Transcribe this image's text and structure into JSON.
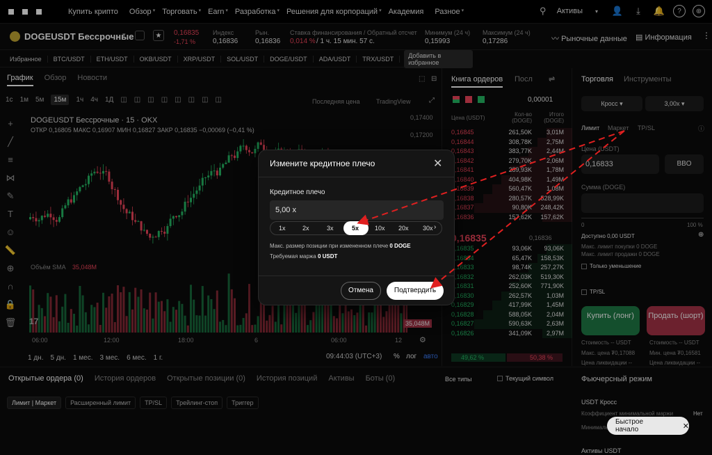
{
  "nav": {
    "items": [
      "Купить крипто",
      "Обзор",
      "Торговать",
      "Earn",
      "Разработка",
      "Решения для корпораций",
      "Академия",
      "Разное"
    ],
    "assets_label": "Активы"
  },
  "ticker": {
    "symbol": "DOGEUSDT Бессрочные",
    "price": "0,16835",
    "change": "-1,71 %",
    "index_label": "Индекс",
    "index_value": "0,16836",
    "mark_label": "Рын.",
    "mark_value": "0,16836",
    "funding_label": "Ставка финансирования / Обратный отсчет",
    "funding_rate": "0,014 %",
    "funding_countdown": "/ 1 ч. 15 мин. 57 с.",
    "min_label": "Минимум (24 ч)",
    "min_value": "0,15993",
    "max_label": "Максимум (24 ч)",
    "max_value": "0,17286",
    "market_data": "Рыночные данные",
    "info": "Информация"
  },
  "favorites": {
    "label": "Избранное",
    "pairs": [
      "BTC/USDT",
      "ETH/USDT",
      "OKB/USDT",
      "XRP/USDT",
      "SOL/USDT",
      "DOGE/USDT",
      "ADA/USDT",
      "TRX/USDT"
    ],
    "add": "Добавить в избранное"
  },
  "chart": {
    "tabs": [
      "График",
      "Обзор",
      "Новости"
    ],
    "timeframes": [
      "1с",
      "1м",
      "5м",
      "15м",
      "1ч",
      "4ч",
      "1Д"
    ],
    "active_tf": "15м",
    "last_price_label": "Последняя цена",
    "tradingview_label": "TradingView",
    "title": "DOGEUSDT Бессрочные · 15 · OKX",
    "ohlc": "ОТКР 0,16805 МАКС 0,16907 МИН 0,16827 ЗАКР 0,16835 −0,00069 (−0,41 %)",
    "volume_label": "Объём SMA",
    "volume_value": "35,048M",
    "volume_axis_value": "35,048M",
    "price_ticks": [
      "0,17400",
      "0,17200"
    ],
    "time_ticks": [
      "06:00",
      "12:00",
      "18:00",
      "6",
      "06:00",
      "12"
    ],
    "ranges": [
      "1 дн.",
      "5 дн.",
      "1 мес.",
      "3 мес.",
      "6 мес.",
      "1 г."
    ],
    "clock": "09:44:03 (UTC+3)",
    "percent": "%",
    "log": "лог",
    "auto": "авто"
  },
  "orderbook": {
    "tab_book": "Книга ордеров",
    "tab_last": "Посл",
    "step": "0,00001",
    "col_price": "Цена (USDT)",
    "col_qty": "Кол-во (DOGE)",
    "col_total": "Итого (DOGE)",
    "asks": [
      [
        "0,16845",
        "261,50K",
        "3,01M"
      ],
      [
        "0,16844",
        "308,78K",
        "2,75M"
      ],
      [
        "0,16843",
        "383,77K",
        "2,44M"
      ],
      [
        "0,16842",
        "279,70K",
        "2,06M"
      ],
      [
        "0,16841",
        "289,93K",
        "1,78M"
      ],
      [
        "0,16840",
        "404,98K",
        "1,49M"
      ],
      [
        "0,16839",
        "560,47K",
        "1,08M"
      ],
      [
        "0,16838",
        "280,57K",
        "528,99K"
      ],
      [
        "0,16837",
        "90,80K",
        "248,42K"
      ],
      [
        "0,16836",
        "157,62K",
        "157,62K"
      ]
    ],
    "mid_price": "0,16835",
    "mid_mark": "0,16836",
    "bids": [
      [
        "0,16835",
        "93,06K",
        "93,06K"
      ],
      [
        "0,16834",
        "65,47K",
        "158,53K"
      ],
      [
        "0,16833",
        "98,74K",
        "257,27K"
      ],
      [
        "0,16832",
        "262,03K",
        "519,30K"
      ],
      [
        "0,16831",
        "252,60K",
        "771,90K"
      ],
      [
        "0,16830",
        "262,57K",
        "1,03M"
      ],
      [
        "0,16829",
        "417,99K",
        "1,45M"
      ],
      [
        "0,16828",
        "588,05K",
        "2,04M"
      ],
      [
        "0,16827",
        "590,63K",
        "2,63M"
      ],
      [
        "0,16826",
        "341,09K",
        "2,97M"
      ]
    ],
    "buy_pct": "49,62 %",
    "sell_pct": "50,38 %"
  },
  "trade": {
    "tab_trade": "Торговля",
    "tab_tools": "Инструменты",
    "margin_mode": "Кросс",
    "leverage": "3,00x",
    "order_types": [
      "Лимит",
      "Маркет",
      "TP/SL"
    ],
    "price_label": "Цена (USDT)",
    "price_value": "0,16833",
    "bbo": "BBO",
    "amount_label": "Сумма (DOGE)",
    "slider_min": "0",
    "slider_max": "100 %",
    "available": "Доступно 0,00 USDT",
    "max_buy": "Макс. лимит покупки 0 DOGE",
    "max_sell": "Макс. лимит продажи 0 DOGE",
    "reduce_only": "Только уменьшение",
    "tpsl": "TP/SL",
    "buy_label": "Купить (лонг)",
    "sell_label": "Продать (шорт)",
    "cost_buy": "Стоимость -- USDT",
    "cost_sell": "Стоимость -- USDT",
    "max_price": "Макс. цена ₮0,17088",
    "min_price": "Мин. цена ₮0,16581",
    "liq_buy": "Цена ликвидации --",
    "liq_sell": "Цена ликвидации --"
  },
  "orders": {
    "tabs": [
      "Открытые ордера (0)",
      "История ордеров",
      "Открытые позиции (0)",
      "История позиций",
      "Активы",
      "Боты (0)"
    ],
    "all_types": "Все типы",
    "current_symbol": "Текущий символ",
    "chips": [
      "Лимит | Маркет",
      "Расширенный лимит",
      "TP/SL",
      "Трейлинг-стоп",
      "Триггер"
    ]
  },
  "futures": {
    "title": "Фьючерсный режим",
    "mode": "USDT Кросс",
    "ratio_label": "Коэффициент минимальной маржи",
    "ratio_value": "Нет",
    "min_label": "Минимальн",
    "assets": "Активы USDT"
  },
  "modal": {
    "title": "Измените кредитное плечо",
    "leverage_label": "Кредитное плечо",
    "leverage_value": "5,00 x",
    "options": [
      "1x",
      "2x",
      "3x",
      "5x",
      "10x",
      "20x",
      "30x"
    ],
    "selected": "5x",
    "max_position_label": "Макс. размер позиции при измененном плече",
    "max_position_value": "0 DOGE",
    "required_margin_label": "Требуемая маржа",
    "required_margin_value": "0 USDT",
    "cancel": "Отмена",
    "confirm": "Подтвердить"
  },
  "toast": {
    "label": "Быстрое начало"
  },
  "colors": {
    "up": "#25b865",
    "down": "#f0455b",
    "annotation": "#e02020"
  }
}
